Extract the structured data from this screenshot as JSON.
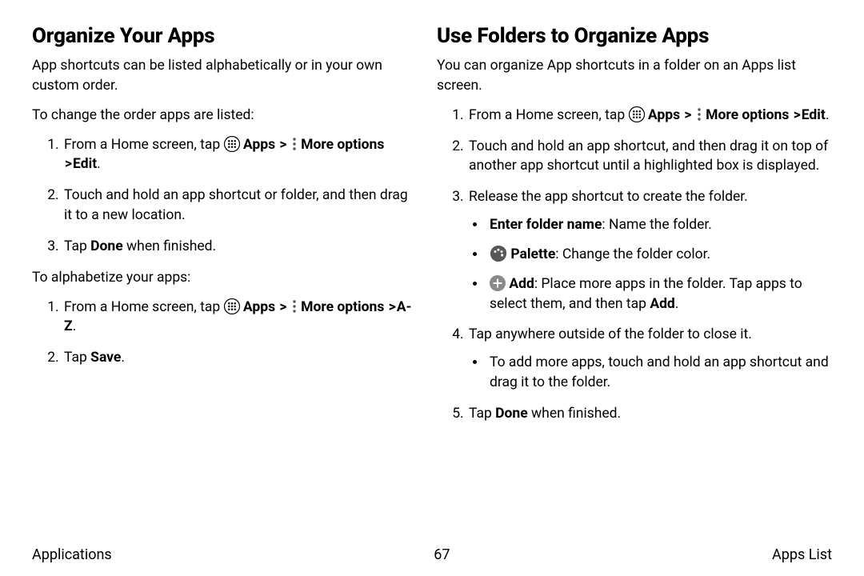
{
  "left": {
    "heading": "Organize Your Apps",
    "intro": "App shortcuts can be listed alphabetically or in your own custom order.",
    "lead1": "To change the order apps are listed:",
    "step1_prefix": "From a Home screen, tap ",
    "apps_word": "Apps",
    "more_options": "More options",
    "edit_suffix": "Edit",
    "step2": "Touch and hold an app shortcut or folder, and then drag it to a new location.",
    "step3_prefix": "Tap ",
    "done_word": "Done",
    "step3_suffix": " when finished.",
    "lead2": "To alphabetize your apps:",
    "az_suffix": "A-Z",
    "step2b_prefix": "Tap ",
    "save_word": "Save"
  },
  "right": {
    "heading": "Use Folders to Organize Apps",
    "intro": "You can organize App shortcuts in a folder on an Apps list screen.",
    "step2": "Touch and hold an app shortcut, and then drag it on top of another app shortcut until a highlighted box is displayed.",
    "step3": "Release the app shortcut to create the folder.",
    "b_enter_name_bold": "Enter folder name",
    "b_enter_name_rest": ": Name the folder.",
    "b_palette_bold": "Palette",
    "b_palette_rest": ": Change the folder color.",
    "b_add_bold": "Add",
    "b_add_rest_a": ": Place more apps in the folder. Tap apps to select them, and then tap ",
    "b_add_rest_b": "Add",
    "step4": "Tap anywhere outside of the folder to close it.",
    "b_more": "To add more apps, touch and hold an app shortcut and drag it to the folder.",
    "step5_prefix": "Tap ",
    "step5_suffix": " when finished."
  },
  "footer": {
    "left": "Applications",
    "center": "67",
    "right": "Apps List"
  },
  "glyphs": {
    "gt": ">",
    "period": "."
  }
}
